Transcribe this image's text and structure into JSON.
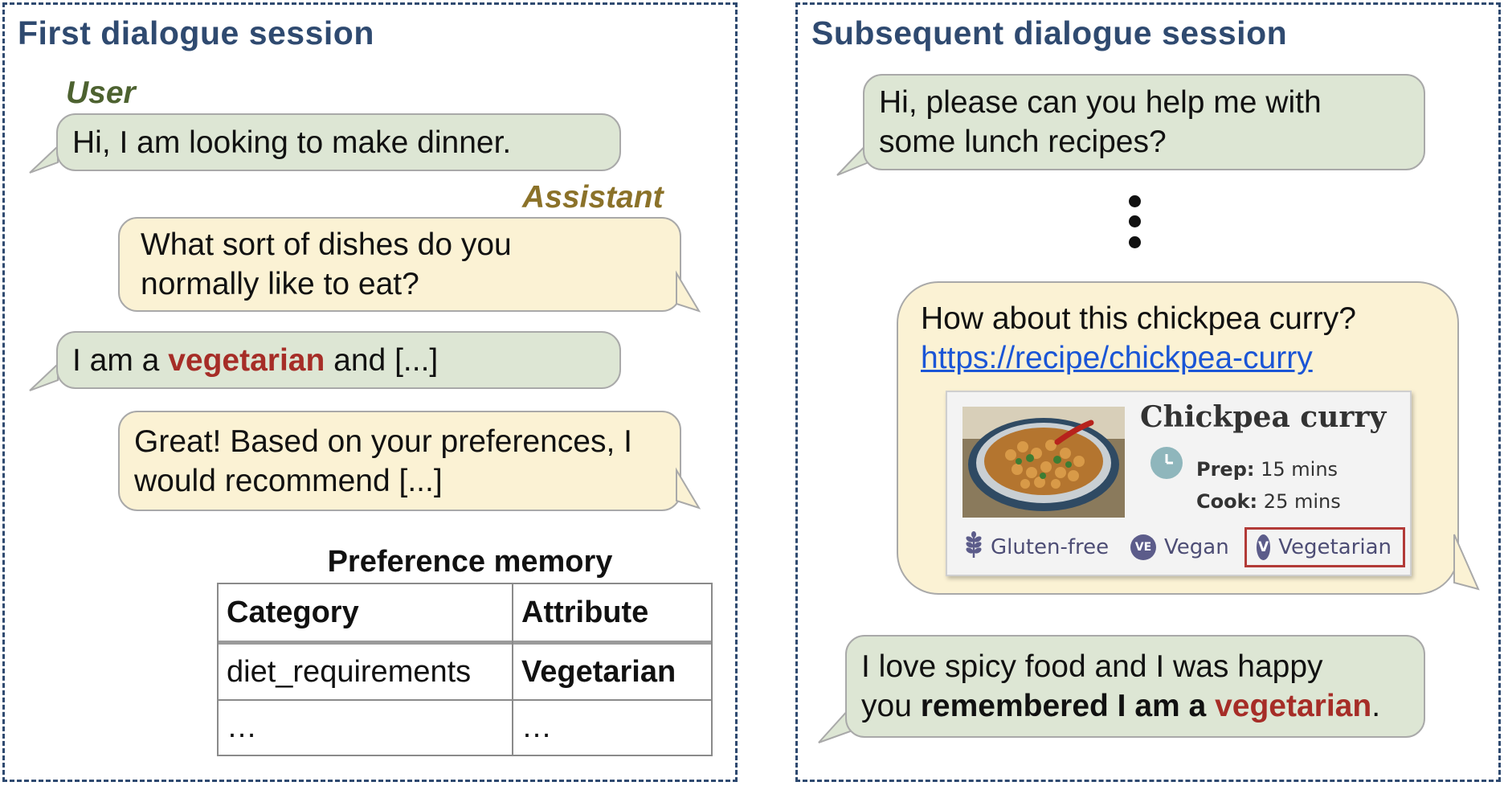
{
  "first_session": {
    "title": "First dialogue session",
    "user_label": "User",
    "assistant_label": "Assistant",
    "messages": [
      {
        "role": "user",
        "text": "Hi, I am looking to make dinner."
      },
      {
        "role": "assistant",
        "line1": "What sort of dishes do you",
        "line2": "normally like to eat?"
      },
      {
        "role": "user",
        "pre": "I am a ",
        "highlight": "vegetarian",
        "post": " and [...]"
      },
      {
        "role": "assistant",
        "line1": "Great! Based on your preferences, I",
        "line2": "would recommend [...]"
      }
    ],
    "memory": {
      "title": "Preference memory",
      "headers": [
        "Category",
        "Attribute"
      ],
      "rows": [
        [
          "diet_requirements",
          "Vegetarian"
        ],
        [
          "…",
          "…"
        ]
      ]
    }
  },
  "subsequent_session": {
    "title": "Subsequent dialogue session",
    "messages": [
      {
        "role": "user",
        "line1": "Hi, please can you help me with",
        "line2": "some lunch recipes?"
      },
      {
        "role": "assistant",
        "line1": "How about this chickpea curry?",
        "link": "https://recipe/chickpea-curry"
      },
      {
        "role": "user",
        "line1": "I love spicy food and I was happy",
        "line2_pre": "you ",
        "line2_bold": "remembered I am a ",
        "line2_highlight": "vegetarian",
        "line2_post": "."
      }
    ],
    "recipe_card": {
      "title": "Chickpea curry",
      "prep_label": "Prep:",
      "prep_value": "15 mins",
      "cook_label": "Cook:",
      "cook_value": "25 mins",
      "tags": [
        {
          "icon": "wheat-icon",
          "label": "Gluten-free"
        },
        {
          "icon": "vegan-badge-icon",
          "badge": "VE",
          "label": "Vegan"
        },
        {
          "icon": "vegetarian-badge-icon",
          "badge": "V",
          "label": "Vegetarian"
        }
      ]
    }
  },
  "colors": {
    "title": "#2f4a70",
    "user_bubble": "#dde6d4",
    "assistant_bubble": "#fbf2d4",
    "highlight": "#a62d27",
    "link": "#1a55d6"
  }
}
